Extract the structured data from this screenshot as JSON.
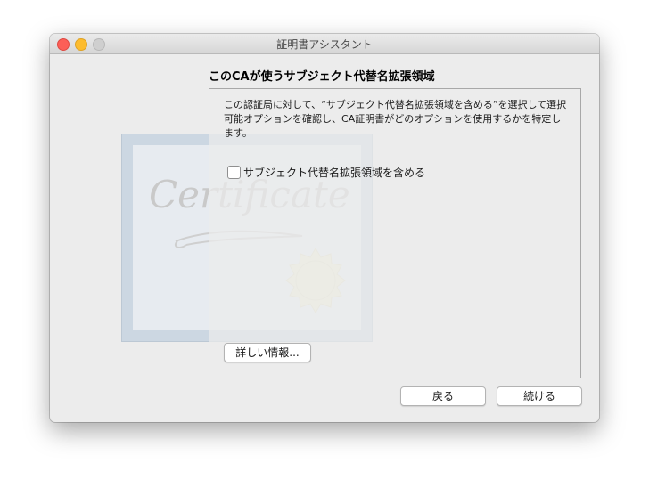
{
  "window": {
    "title": "証明書アシスタント"
  },
  "certificate_graphic": {
    "text": "Certificate"
  },
  "page": {
    "heading": "このCAが使うサブジェクト代替名拡張領域",
    "description": "この認証局に対して、“サブジェクト代替名拡張領域を含める”を選択して選択可能オプションを確認し、CA証明書がどのオプションを使用するかを特定します。",
    "checkbox": {
      "label": "サブジェクト代替名拡張領域を含める",
      "checked": false
    }
  },
  "buttons": {
    "more_info": "詳しい情報...",
    "back": "戻る",
    "continue": "続ける"
  }
}
